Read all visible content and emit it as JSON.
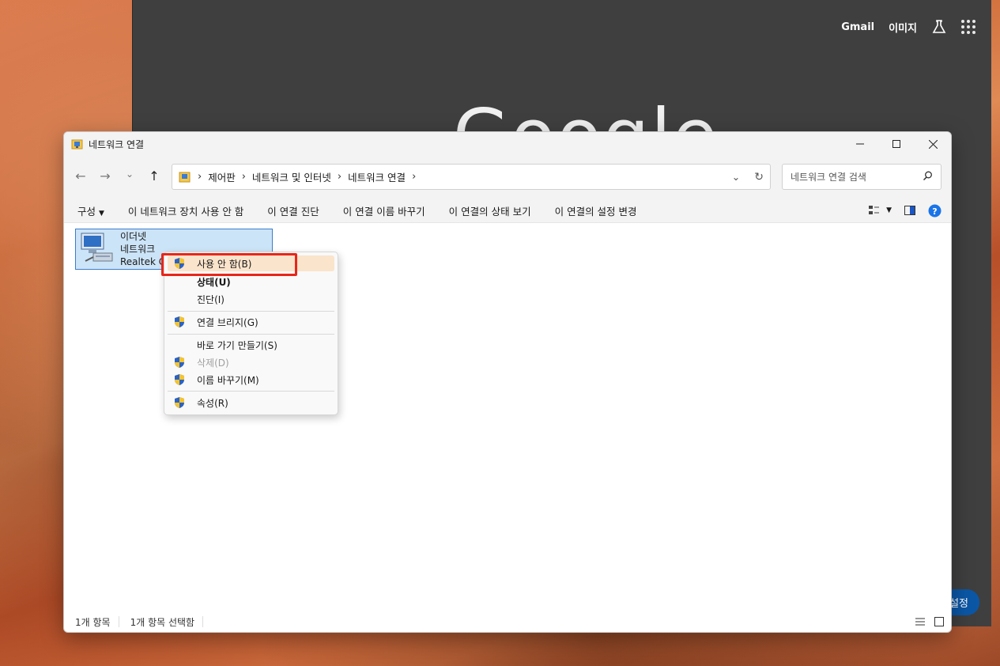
{
  "browser": {
    "links": [
      "Gmail",
      "이미지"
    ],
    "logo_text": "Google",
    "settings_label": "설정"
  },
  "window": {
    "title": "네트워크 연결",
    "breadcrumbs": [
      "제어판",
      "네트워크 및 인터넷",
      "네트워크 연결"
    ],
    "search_placeholder": "네트워크 연결 검색"
  },
  "commands": [
    "구성",
    "이 네트워크 장치 사용 안 함",
    "이 연결 진단",
    "이 연결 이름 바꾸기",
    "이 연결의 상태 보기",
    "이 연결의 설정 변경"
  ],
  "item": {
    "name": "이더넷",
    "network": "네트워크",
    "adapter": "Realtek G"
  },
  "context_menu": [
    {
      "label": "사용 안 함(B)",
      "shield": true,
      "highlighted": true
    },
    {
      "label": "상태(U)",
      "bold": true
    },
    {
      "label": "진단(I)"
    },
    {
      "label": "연결 브리지(G)",
      "shield": true
    },
    {
      "label": "바로 가기 만들기(S)"
    },
    {
      "label": "삭제(D)",
      "shield": true,
      "disabled": true
    },
    {
      "label": "이름 바꾸기(M)",
      "shield": true
    },
    {
      "label": "속성(R)",
      "shield": true
    }
  ],
  "status": {
    "count": "1개 항목",
    "selected": "1개 항목 선택함"
  },
  "colors": {
    "selection": "#cce4f7",
    "highlight_box": "#e8261a",
    "help_icon": "#1a73e8"
  }
}
